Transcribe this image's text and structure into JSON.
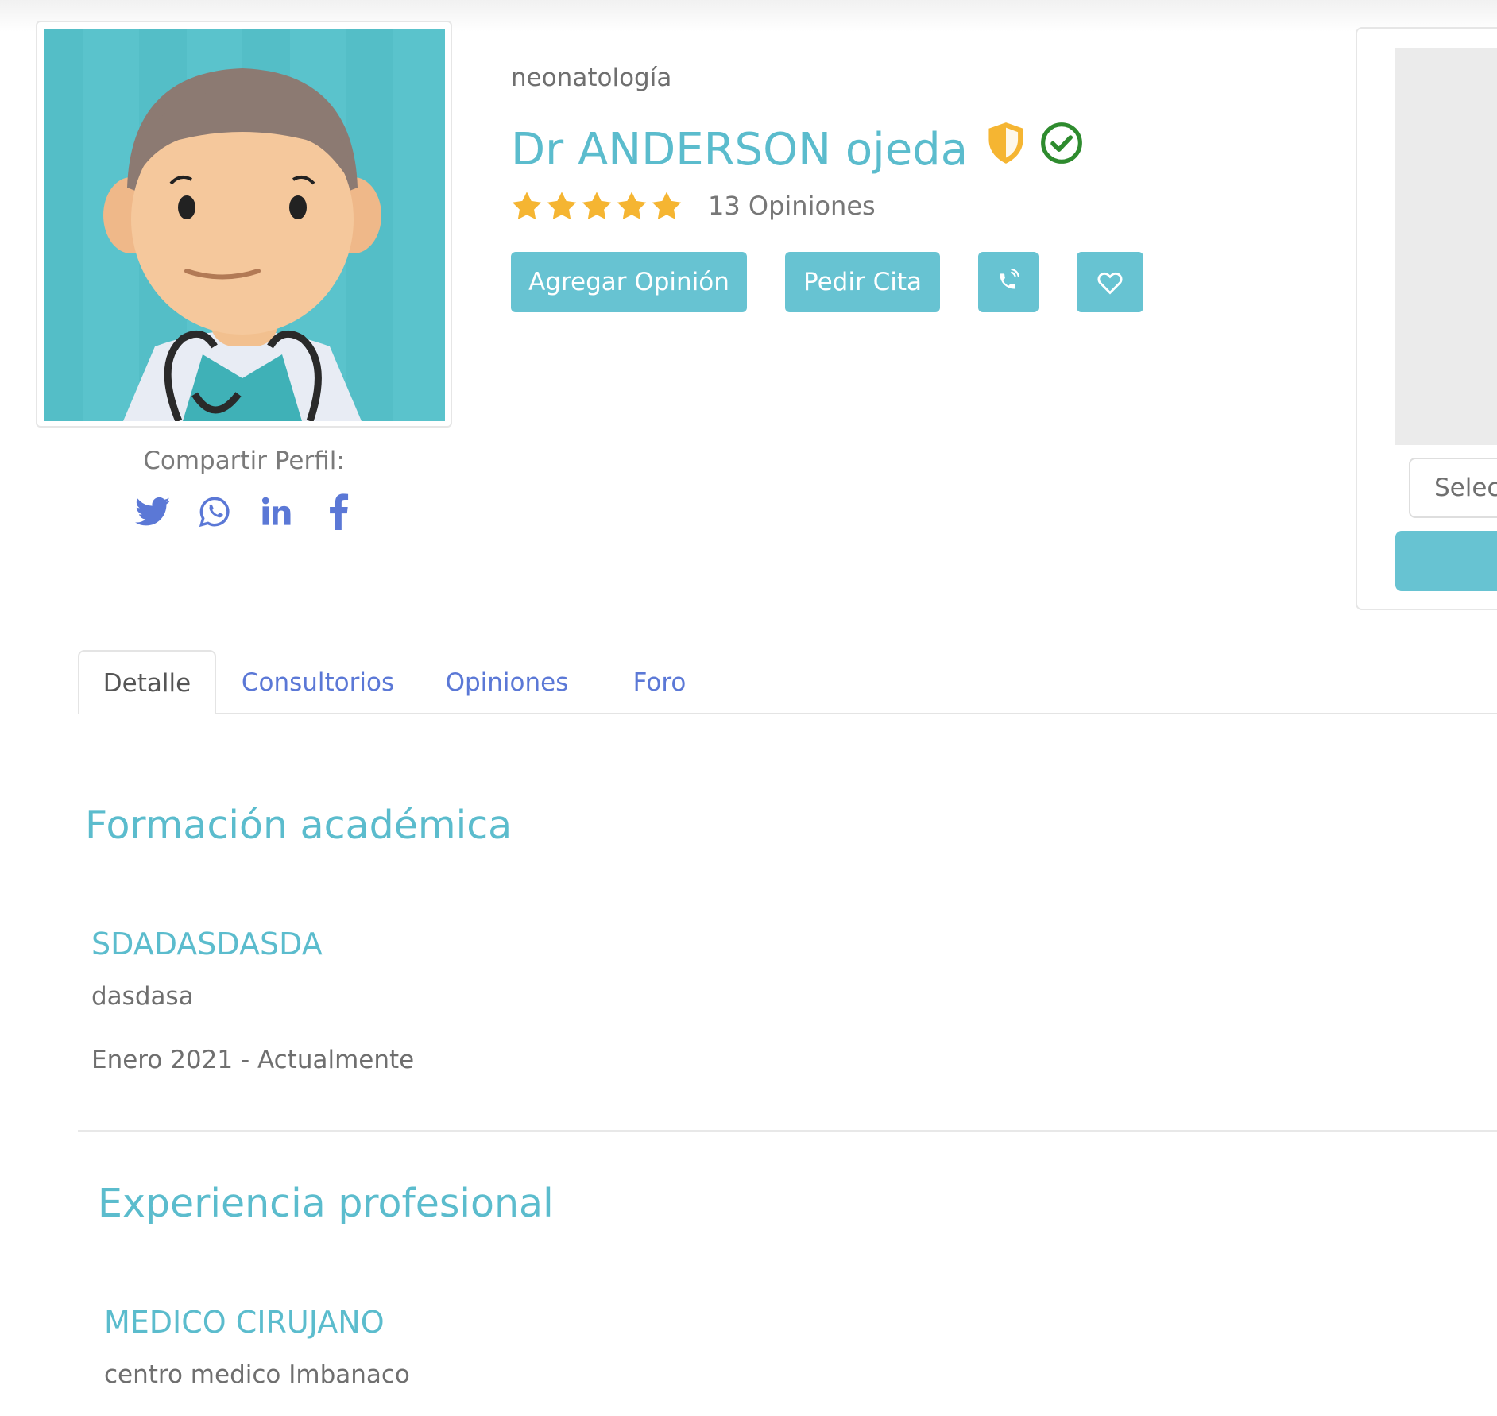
{
  "profile": {
    "specialty": "neonatología",
    "name": "Dr ANDERSON ojeda",
    "rating_stars": 5,
    "reviews_label": "13 Opiniones"
  },
  "share": {
    "label": "Compartir Perfil:",
    "icons": [
      "twitter-icon",
      "whatsapp-icon",
      "linkedin-icon",
      "facebook-icon"
    ]
  },
  "actions": {
    "add_review": "Agregar Opinión",
    "book": "Pedir Cita",
    "call_icon": "phone-icon",
    "favorite_icon": "heart-icon"
  },
  "sidebar": {
    "select_value": "Selec"
  },
  "tabs": [
    {
      "label": "Detalle",
      "active": true
    },
    {
      "label": "Consultorios",
      "active": false
    },
    {
      "label": "Opiniones",
      "active": false
    },
    {
      "label": "Foro",
      "active": false
    }
  ],
  "education": {
    "title": "Formación académica",
    "entries": [
      {
        "title": "SDADASDASDA",
        "institution": "dasdasa",
        "period": "Enero 2021 - Actualmente"
      }
    ]
  },
  "experience": {
    "title": "Experiencia profesional",
    "entries": [
      {
        "title": "MEDICO CIRUJANO",
        "institution": "centro medico Imbanaco"
      }
    ]
  },
  "colors": {
    "accent": "#5bbccd",
    "button": "#67c3d2",
    "link": "#5b78d6",
    "star": "#f5b532",
    "verified": "#2e8b2e",
    "shield": "#f5b532"
  }
}
